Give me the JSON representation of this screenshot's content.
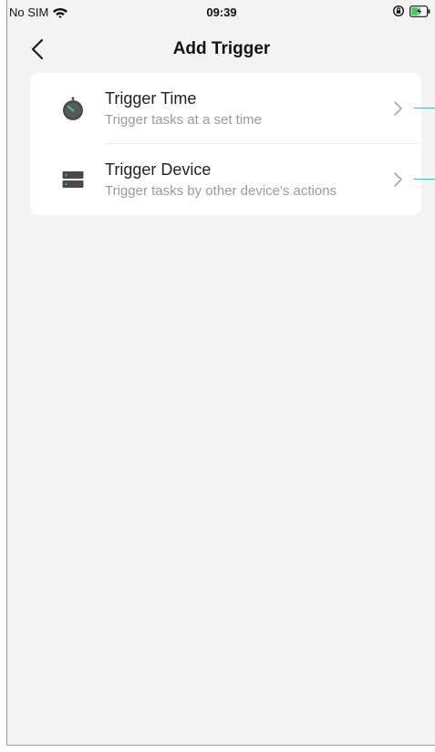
{
  "status_bar": {
    "carrier": "No SIM",
    "time": "09:39",
    "icons": [
      "wifi-icon",
      "orientation-lock-icon",
      "battery-charging-icon"
    ]
  },
  "nav": {
    "title": "Add Trigger",
    "back_icon": "chevron-left-icon"
  },
  "triggers": [
    {
      "title": "Trigger Time",
      "subtitle": "Trigger tasks at a set time",
      "icon": "stopwatch-icon"
    },
    {
      "title": "Trigger Device",
      "subtitle": "Trigger tasks by other device's actions",
      "icon": "device-icon"
    }
  ],
  "colors": {
    "background": "#f4f4f4",
    "card": "#ffffff",
    "accent_line": "#4fb7b0",
    "icon_dark": "#4a4a4a",
    "icon_accent": "#4fb7b0"
  }
}
